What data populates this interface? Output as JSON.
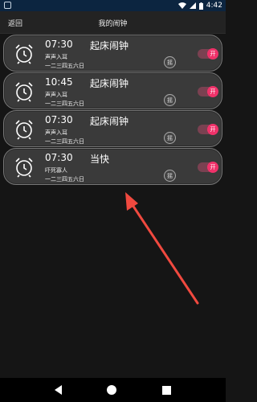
{
  "status_bar": {
    "time": "4:42",
    "icons": [
      "wifi-icon",
      "signal-icon",
      "battery-icon"
    ]
  },
  "app_bar": {
    "back_label": "返回",
    "title": "我的闹钟"
  },
  "alarms": [
    {
      "time": "07:30",
      "name": "起床闹钟",
      "sound": "声声入耳",
      "days": "一二三四五六日",
      "shake": "摇",
      "toggle": "开",
      "enabled": true
    },
    {
      "time": "10:45",
      "name": "起床闹钟",
      "sound": "声声入耳",
      "days": "一二三四五六日",
      "shake": "摇",
      "toggle": "开",
      "enabled": true
    },
    {
      "time": "07:30",
      "name": "起床闹钟",
      "sound": "声声入耳",
      "days": "一二三四五六日",
      "shake": "摇",
      "toggle": "开",
      "enabled": true
    },
    {
      "time": "07:30",
      "name": "当快",
      "sound": "吓死寡人",
      "days": "一二三四五六日",
      "shake": "摇",
      "toggle": "开",
      "enabled": true
    }
  ],
  "colors": {
    "toggle_on": "#f0326a",
    "status_bar": "#0c2540",
    "annotation_arrow": "#f0493f"
  }
}
